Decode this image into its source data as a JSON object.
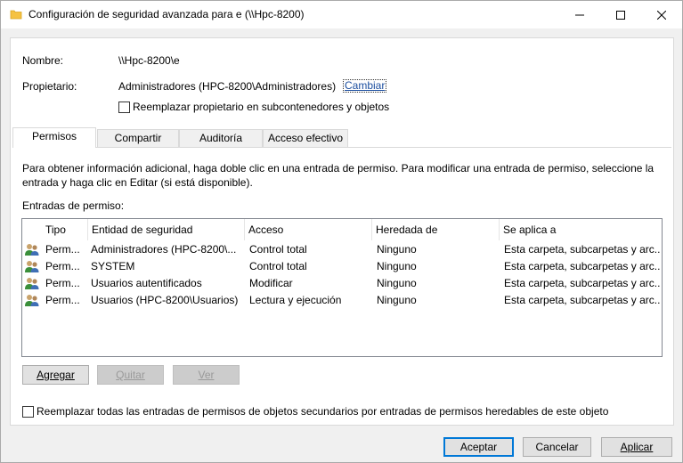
{
  "window": {
    "title": "Configuración de seguridad avanzada para e (\\\\Hpc-8200)"
  },
  "info": {
    "name_label": "Nombre:",
    "name_value": "\\\\Hpc-8200\\e",
    "owner_label": "Propietario:",
    "owner_value": "Administradores (HPC-8200\\Administradores)",
    "change_link": "Cambiar",
    "replace_owner_label": "Reemplazar propietario en subcontenedores y objetos"
  },
  "tabs": [
    {
      "label": "Permisos"
    },
    {
      "label": "Compartir"
    },
    {
      "label": "Auditoría"
    },
    {
      "label": "Acceso efectivo"
    }
  ],
  "permissions": {
    "help_text_1": "Para obtener información adicional, haga doble clic en una entrada de permiso. Para modificar una entrada de permiso, seleccione la",
    "help_text_2": "entrada y haga clic en Editar (si está disponible).",
    "entries_label": "Entradas de permiso:",
    "columns": [
      "Tipo",
      "Entidad de seguridad",
      "Acceso",
      "Heredada de",
      "Se aplica a"
    ],
    "rows": [
      {
        "type": "Perm...",
        "principal": "Administradores (HPC-8200\\...",
        "access": "Control total",
        "inherited": "Ninguno",
        "applies": "Esta carpeta, subcarpetas y arc..."
      },
      {
        "type": "Perm...",
        "principal": "SYSTEM",
        "access": "Control total",
        "inherited": "Ninguno",
        "applies": "Esta carpeta, subcarpetas y arc..."
      },
      {
        "type": "Perm...",
        "principal": "Usuarios autentificados",
        "access": "Modificar",
        "inherited": "Ninguno",
        "applies": "Esta carpeta, subcarpetas y arc..."
      },
      {
        "type": "Perm...",
        "principal": "Usuarios (HPC-8200\\Usuarios)",
        "access": "Lectura y ejecución",
        "inherited": "Ninguno",
        "applies": "Esta carpeta, subcarpetas y arc..."
      }
    ],
    "add_label": "Agregar",
    "remove_label": "Quitar",
    "view_label": "Ver",
    "replace_all_label": "Reemplazar todas las entradas de permisos de objetos secundarios por entradas de permisos heredables de este objeto"
  },
  "footer": {
    "ok_label": "Aceptar",
    "cancel_label": "Cancelar",
    "apply_label": "Aplicar"
  },
  "colors": {
    "accent": "#0078d7",
    "link": "#1a4d9e",
    "folder": "#f5c242"
  }
}
